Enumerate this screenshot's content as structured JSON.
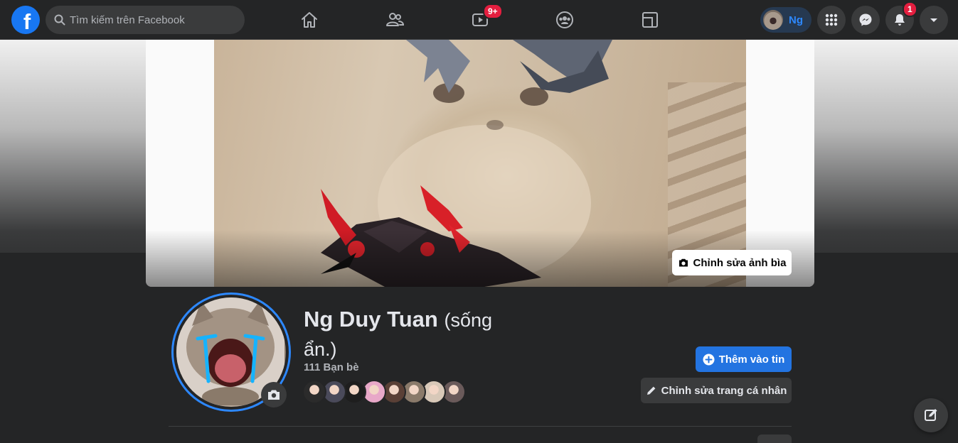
{
  "topbar": {
    "logo": "f",
    "search": {
      "placeholder": "Tìm kiếm trên Facebook",
      "value": ""
    },
    "tabs": [
      {
        "icon": "home-icon"
      },
      {
        "icon": "friends-icon"
      },
      {
        "icon": "watch-icon",
        "badge": "9+"
      },
      {
        "icon": "groups-icon"
      },
      {
        "icon": "gaming-icon"
      }
    ],
    "profile_chip": {
      "name": "Ng"
    },
    "notifications_badge": "1"
  },
  "cover": {
    "edit_label": "Chỉnh sửa ảnh bìa"
  },
  "profile": {
    "name": "Ng Duy Tuan",
    "alternate_name": "(sống ẩn.)",
    "friends_count": "111 Bạn bè",
    "friend_avatar_colors": [
      "#2b2b2b",
      "#4a4a5a",
      "#1e1e1e",
      "#e8a8c8",
      "#5a4036",
      "#8a7a6a",
      "#d8c8b8",
      "#6a5a5a"
    ],
    "add_story_label": "Thêm vào tin",
    "edit_profile_label": "Chỉnh sửa trang cá nhân"
  },
  "colors": {
    "accent": "#2374e1",
    "background": "#18191a",
    "surface": "#242526",
    "badge": "#e41e3f"
  }
}
